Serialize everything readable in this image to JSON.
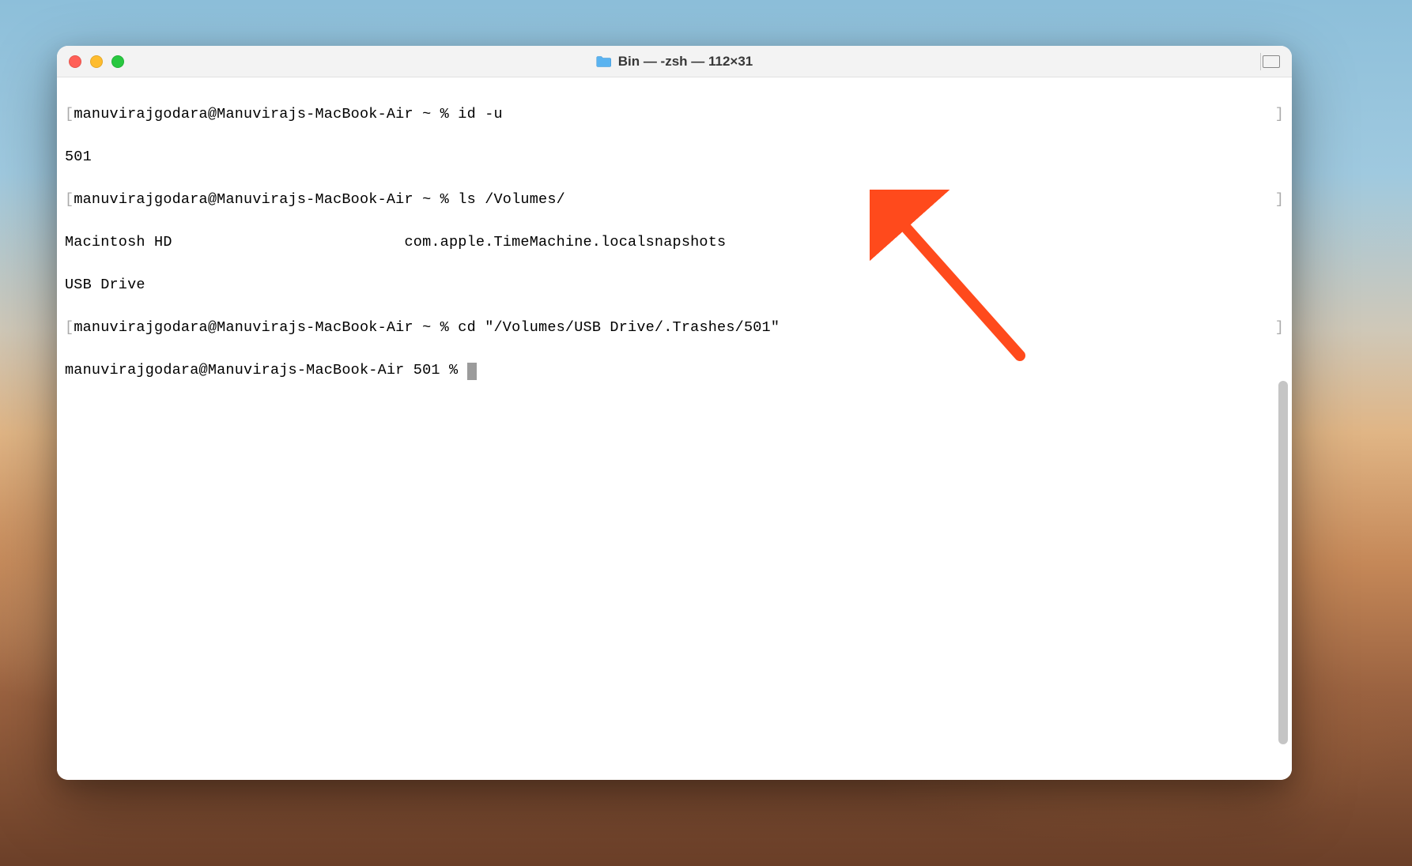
{
  "window": {
    "title": "Bin — -zsh — 112×31"
  },
  "terminal": {
    "lines": [
      {
        "prefix": "[",
        "prompt": "manuvirajgodara@Manuvirajs-MacBook-Air ~ % ",
        "cmd": "id -u",
        "suffix": "]"
      },
      {
        "text": "501"
      },
      {
        "prefix": "[",
        "prompt": "manuvirajgodara@Manuvirajs-MacBook-Air ~ % ",
        "cmd": "ls /Volumes/",
        "suffix": "]"
      },
      {
        "text": "Macintosh HD                          com.apple.TimeMachine.localsnapshots"
      },
      {
        "text": "USB Drive"
      },
      {
        "prefix": "[",
        "prompt": "manuvirajgodara@Manuvirajs-MacBook-Air ~ % ",
        "cmd": "cd \"/Volumes/USB Drive/.Trashes/501\"",
        "suffix": "]"
      },
      {
        "prompt": "manuvirajgodara@Manuvirajs-MacBook-Air 501 % ",
        "cursor": true
      }
    ]
  },
  "colors": {
    "close": "#ff5f57",
    "minimize": "#febc2e",
    "maximize": "#28c840",
    "arrow": "#ff4a1c"
  }
}
